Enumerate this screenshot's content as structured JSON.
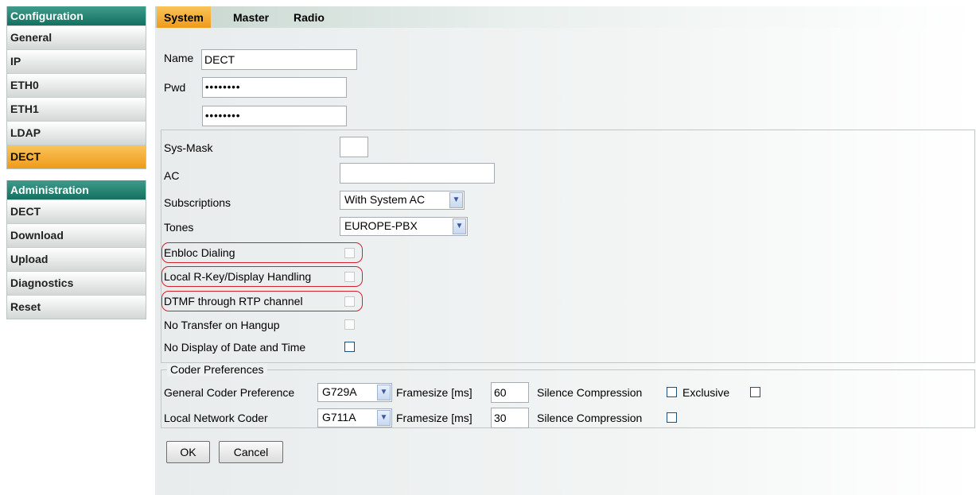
{
  "sidebar": {
    "configuration": {
      "title": "Configuration",
      "items": [
        "General",
        "IP",
        "ETH0",
        "ETH1",
        "LDAP",
        "DECT"
      ],
      "active": "DECT"
    },
    "administration": {
      "title": "Administration",
      "items": [
        "DECT",
        "Download",
        "Upload",
        "Diagnostics",
        "Reset"
      ]
    }
  },
  "tabs": [
    "System",
    "Master",
    "Radio"
  ],
  "active_tab": "System",
  "form": {
    "name_label": "Name",
    "name_value": "DECT",
    "pwd_label": "Pwd",
    "pwd_value": "••••••••",
    "pwd_confirm_value": "••••••••",
    "sys_mask_label": "Sys-Mask",
    "sys_mask_value": "",
    "ac_label": "AC",
    "ac_value": "",
    "subscriptions_label": "Subscriptions",
    "subscriptions_value": "With System AC",
    "tones_label": "Tones",
    "tones_value": "EUROPE-PBX",
    "enbloc_label": "Enbloc Dialing",
    "local_rkey_label": "Local R-Key/Display Handling",
    "dtmf_label": "DTMF through RTP channel",
    "no_transfer_label": "No Transfer on Hangup",
    "no_display_label": "No Display of Date and Time"
  },
  "coder": {
    "legend": "Coder Preferences",
    "general_label": "General Coder Preference",
    "general_value": "G729A",
    "local_label": "Local Network Coder",
    "local_value": "G711A",
    "framesize_label": "Framesize [ms]",
    "general_framesize": "60",
    "local_framesize": "30",
    "silence_label": "Silence Compression",
    "exclusive_label": "Exclusive"
  },
  "buttons": {
    "ok": "OK",
    "cancel": "Cancel"
  },
  "colors": {
    "header_green": "#14705f",
    "active_orange": "#ef9b1b",
    "highlight_red": "#d6202a"
  }
}
